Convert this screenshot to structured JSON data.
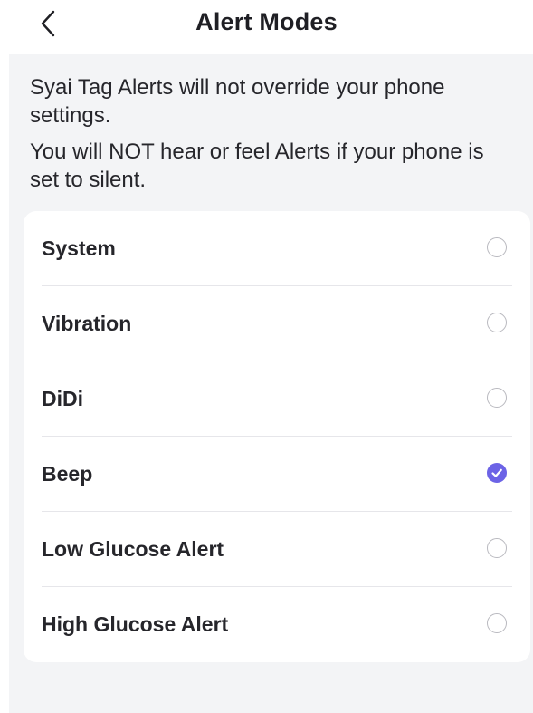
{
  "header": {
    "title": "Alert Modes",
    "back_icon": "chevron-left-icon"
  },
  "notices": [
    "Syai Tag Alerts will not override your phone settings.",
    "You will NOT hear or feel Alerts if your phone is set to silent."
  ],
  "options": [
    {
      "label": "System",
      "selected": false
    },
    {
      "label": "Vibration",
      "selected": false
    },
    {
      "label": "DiDi",
      "selected": false
    },
    {
      "label": "Beep",
      "selected": true
    },
    {
      "label": "Low Glucose Alert",
      "selected": false
    },
    {
      "label": "High Glucose Alert",
      "selected": false
    }
  ],
  "colors": {
    "accent": "#6c63e6",
    "background": "#f3f4f6",
    "card": "#ffffff",
    "divider": "#e6e6ea"
  }
}
